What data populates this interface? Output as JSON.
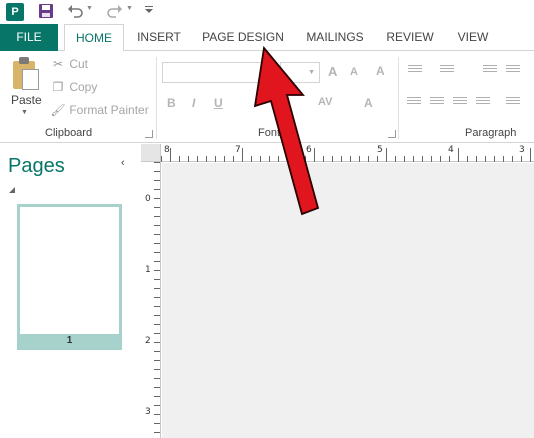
{
  "qat": {
    "app_letter": "P",
    "save_icon": "save-icon",
    "undo_icon": "undo-icon",
    "redo_icon": "redo-icon",
    "customize_icon": "customize-qat-icon"
  },
  "tabs": [
    {
      "label": "FILE"
    },
    {
      "label": "HOME"
    },
    {
      "label": "INSERT"
    },
    {
      "label": "PAGE DESIGN"
    },
    {
      "label": "MAILINGS"
    },
    {
      "label": "REVIEW"
    },
    {
      "label": "VIEW"
    }
  ],
  "clipboard": {
    "paste_label": "Paste",
    "cut_label": "Cut",
    "copy_label": "Copy",
    "format_painter_label": "Format Painter",
    "group_label": "Clipboard"
  },
  "font": {
    "group_label": "Font",
    "bold": "B",
    "italic": "I",
    "underline": "U",
    "grow": "A",
    "shrink": "A",
    "clear": "A",
    "spacing": "AV",
    "color": "A"
  },
  "paragraph": {
    "group_label": "Paragraph"
  },
  "pages_pane": {
    "title": "Pages",
    "collapse_glyph": "‹",
    "thumb_number": "1"
  },
  "ruler": {
    "horizontal_labels": [
      "8",
      "7",
      "6",
      "5",
      "4",
      "3"
    ],
    "vertical_labels": [
      "0",
      "1",
      "2",
      "3"
    ]
  },
  "colors": {
    "accent": "#077568",
    "arrow": "#e0151d"
  }
}
